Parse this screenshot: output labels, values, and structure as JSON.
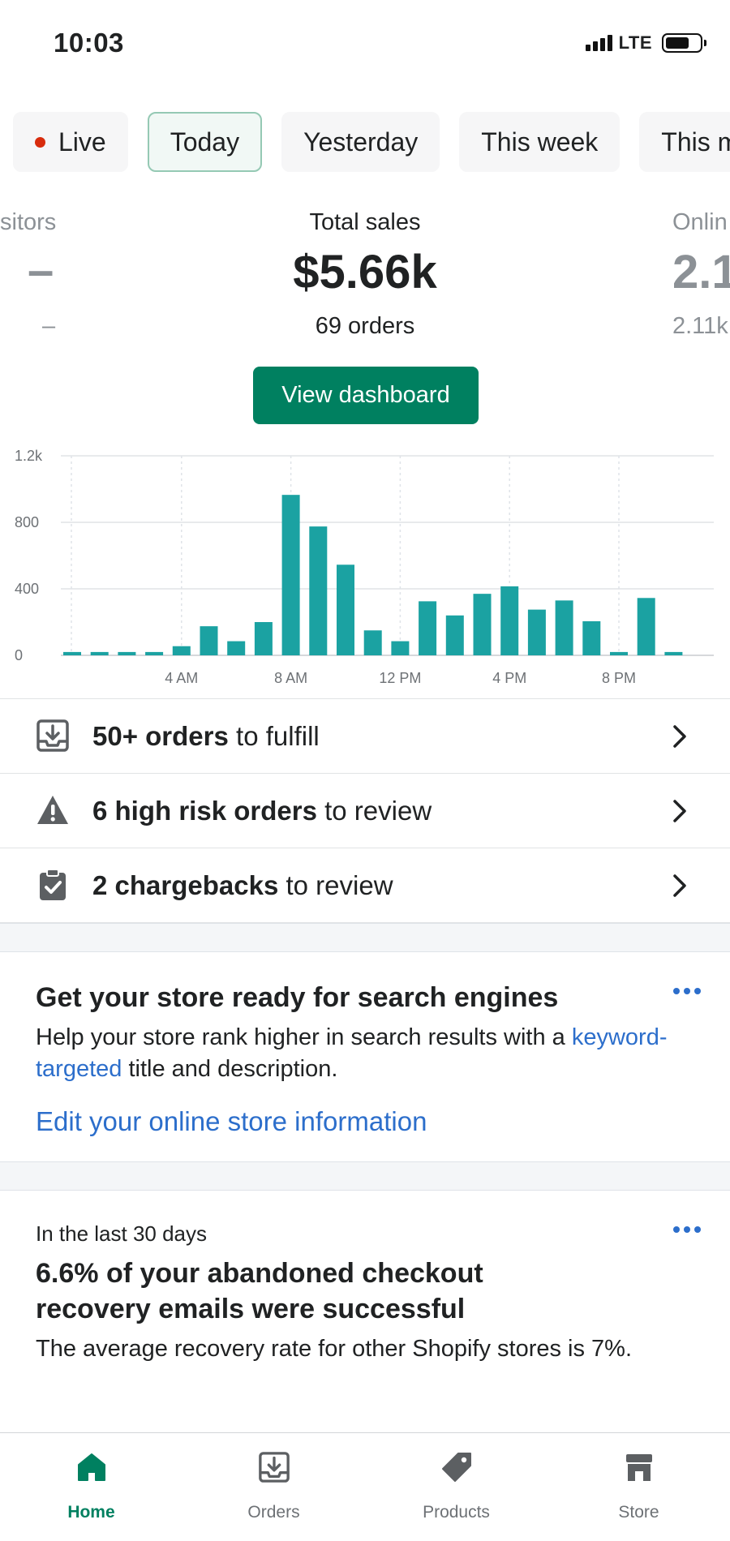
{
  "status_bar": {
    "time": "10:03",
    "network": "LTE"
  },
  "periods": [
    {
      "label": "Live",
      "live": true
    },
    {
      "label": "Today",
      "active": true
    },
    {
      "label": "Yesterday"
    },
    {
      "label": "This week"
    },
    {
      "label": "This m"
    }
  ],
  "metrics": {
    "visitors": {
      "label": "sitors",
      "value": "–",
      "sub": "–"
    },
    "total_sales": {
      "label": "Total sales",
      "value": "$5.66k",
      "sub": "69 orders"
    },
    "online": {
      "label": "Onlin",
      "value": "2.1",
      "sub": "2.11k"
    }
  },
  "view_dashboard_label": "View dashboard",
  "chart_data": {
    "type": "bar",
    "x": [
      0,
      1,
      2,
      3,
      4,
      5,
      6,
      7,
      8,
      9,
      10,
      11,
      12,
      13,
      14,
      15,
      16,
      17,
      18,
      19,
      20,
      21,
      22,
      23
    ],
    "values": [
      20,
      20,
      20,
      20,
      55,
      175,
      85,
      200,
      965,
      775,
      545,
      150,
      85,
      325,
      240,
      370,
      415,
      275,
      330,
      205,
      20,
      345,
      20,
      0
    ],
    "xticks": [
      {
        "x": 4,
        "label": "4 AM"
      },
      {
        "x": 8,
        "label": "8 AM"
      },
      {
        "x": 12,
        "label": "12 PM"
      },
      {
        "x": 16,
        "label": "4 PM"
      },
      {
        "x": 20,
        "label": "8 PM"
      }
    ],
    "yticks": [
      {
        "y": 0,
        "label": "0"
      },
      {
        "y": 400,
        "label": "400"
      },
      {
        "y": 800,
        "label": "800"
      },
      {
        "y": 1200,
        "label": "1.2k"
      }
    ],
    "ylim": [
      0,
      1200
    ],
    "bar_color": "#1ba2a2",
    "grid": true
  },
  "alerts": [
    {
      "bold": "50+ orders",
      "rest": " to fulfill",
      "icon": "inbox-download-icon"
    },
    {
      "bold": "6 high risk orders",
      "rest": " to review",
      "icon": "warning-icon"
    },
    {
      "bold": "2 chargebacks",
      "rest": " to review",
      "icon": "clipboard-check-icon"
    }
  ],
  "seo_card": {
    "title": "Get your store ready for search engines",
    "body_before": "Help your store rank higher in search results with a ",
    "body_link": "keyword-targeted",
    "body_after": " title and description.",
    "action": "Edit your online store information"
  },
  "recovery_card": {
    "eyebrow": "In the last 30 days",
    "title": "6.6% of your abandoned checkout recovery emails were successful",
    "body": "The average recovery rate for other Shopify stores is 7%."
  },
  "tabs": [
    {
      "label": "Home",
      "icon": "home-icon",
      "active": true
    },
    {
      "label": "Orders",
      "icon": "orders-icon"
    },
    {
      "label": "Products",
      "icon": "tag-icon"
    },
    {
      "label": "Store",
      "icon": "store-icon"
    }
  ],
  "colors": {
    "accent": "#008060",
    "link": "#2c6ecb",
    "live": "#d82c0d"
  }
}
